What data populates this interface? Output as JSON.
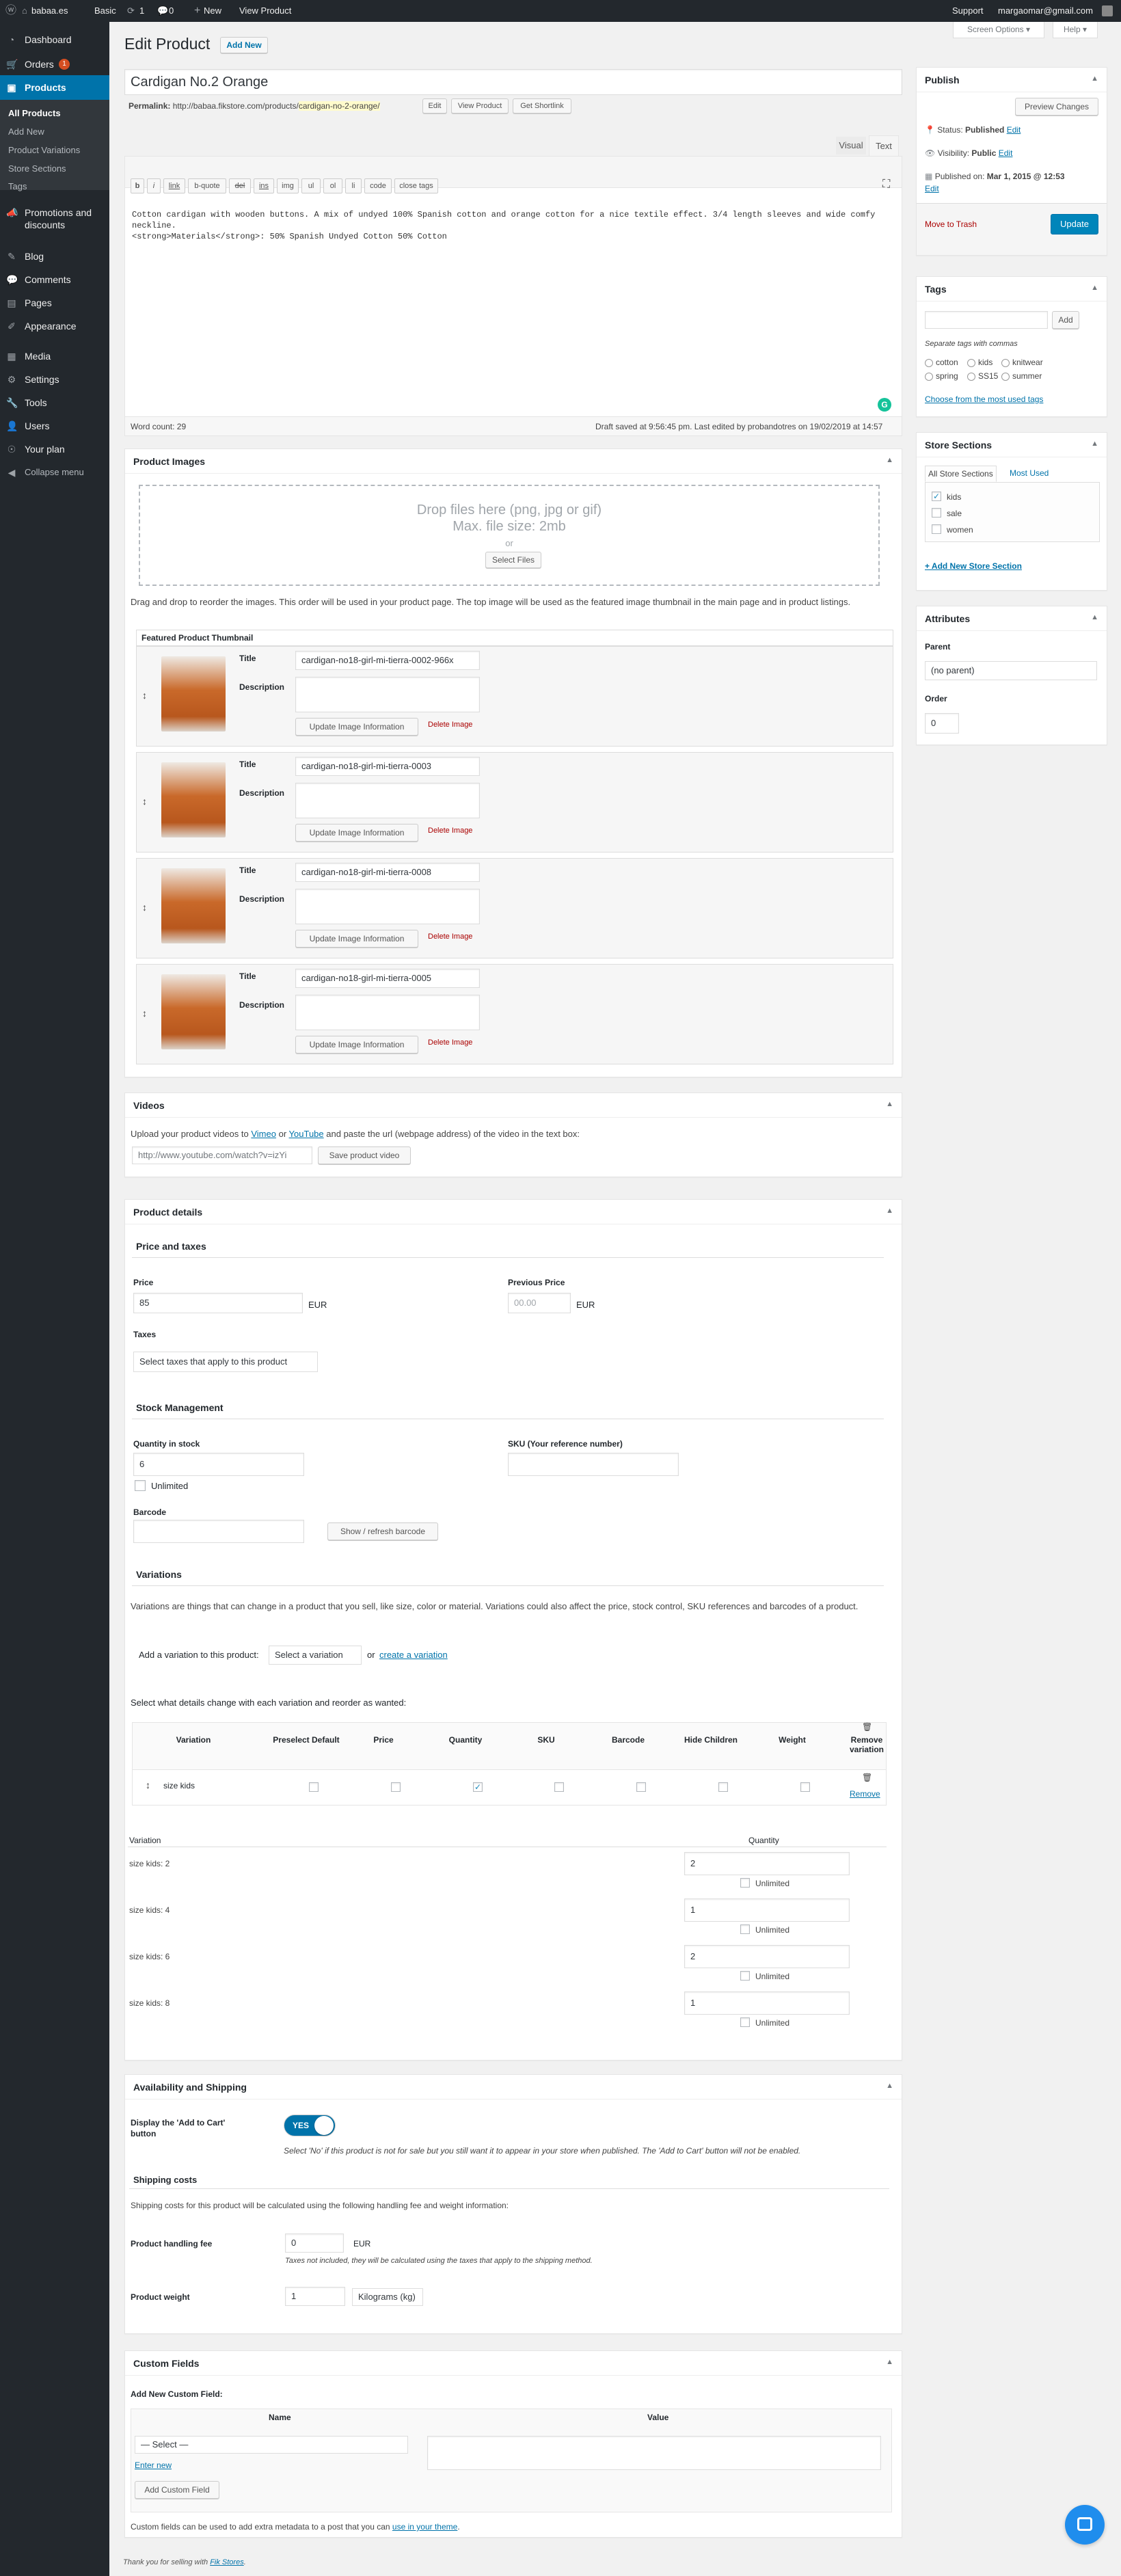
{
  "adminbar": {
    "site": "babaa.es",
    "plan": "Basic",
    "updates": "1",
    "comments": "0",
    "new": "New",
    "view": "View Product",
    "support": "Support",
    "user": "margaomar@gmail.com"
  },
  "menu": {
    "dashboard": "Dashboard",
    "orders": "Orders",
    "orders_badge": "1",
    "products": "Products",
    "products_sub": [
      "All Products",
      "Add New",
      "Product Variations",
      "Store Sections",
      "Tags"
    ],
    "promotions": "Promotions and discounts",
    "blog": "Blog",
    "comments": "Comments",
    "pages": "Pages",
    "appearance": "Appearance",
    "media": "Media",
    "settings": "Settings",
    "tools": "Tools",
    "users": "Users",
    "plan": "Your plan",
    "collapse": "Collapse menu"
  },
  "header": {
    "title": "Edit Product",
    "add_new": "Add New",
    "screen_options": "Screen Options ▾",
    "help": "Help ▾"
  },
  "post": {
    "title": "Cardigan No.2 Orange",
    "permalink_label": "Permalink:",
    "permalink_base": "http://babaa.fikstore.com/products/",
    "permalink_slug": "cardigan-no-2-orange/",
    "edit": "Edit",
    "view_product": "View Product",
    "get_shortlink": "Get Shortlink"
  },
  "editor": {
    "tab_visual": "Visual",
    "tab_text": "Text",
    "quicktags": [
      "b",
      "i",
      "link",
      "b-quote",
      "del",
      "ins",
      "img",
      "ul",
      "ol",
      "li",
      "code",
      "close tags"
    ],
    "content_line1": "Cotton cardigan with wooden buttons. A mix of undyed 100% Spanish cotton and orange cotton for a nice textile effect. 3/4 length sleeves and wide comfy",
    "content_line2": "neckline.",
    "content_line3": "<strong>Materials</strong>: 50% Spanish Undyed Cotton 50% Cotton",
    "word_count": "Word count: 29",
    "draft_saved": "Draft saved at 9:56:45 pm. Last edited by probandotres on 19/02/2019 at 14:57"
  },
  "images": {
    "title": "Product Images",
    "drop": "Drop files here (png, jpg or gif)",
    "max": "Max. file size: 2mb",
    "or": "or",
    "select": "Select Files",
    "help": "Drag and drop to reorder the images. This order will be used in your product page. The top image will be used as the featured image thumbnail in the main page and in product listings.",
    "featured": "Featured Product Thumbnail",
    "title_label": "Title",
    "desc_label": "Description",
    "update": "Update Image Information",
    "delete": "Delete Image",
    "items": [
      {
        "title": "cardigan-no18-girl-mi-tierra-0002-966x"
      },
      {
        "title": "cardigan-no18-girl-mi-tierra-0003"
      },
      {
        "title": "cardigan-no18-girl-mi-tierra-0008"
      },
      {
        "title": "cardigan-no18-girl-mi-tierra-0005"
      }
    ]
  },
  "videos": {
    "title": "Videos",
    "text_pre": "Upload your product videos to",
    "vimeo": "Vimeo",
    "or": "or",
    "youtube": "YouTube",
    "text_post": "and paste the url (webpage address) of the video in the text box:",
    "placeholder": "http://www.youtube.com/watch?v=izYi",
    "save": "Save product video"
  },
  "details": {
    "title": "Product details",
    "price_taxes": "Price and taxes",
    "price_label": "Price",
    "price": "85",
    "currency": "EUR",
    "prev_price_label": "Previous Price",
    "prev_price_placeholder": "00.00",
    "taxes_label": "Taxes",
    "taxes_select": "Select taxes that apply to this product",
    "stock": "Stock Management",
    "qty_label": "Quantity in stock",
    "qty": "6",
    "unlimited": "Unlimited",
    "sku_label": "SKU (Your reference number)",
    "barcode_label": "Barcode",
    "barcode_btn": "Show / refresh barcode",
    "variations": "Variations",
    "var_help": "Variations are things that can change in a product that you sell, like size, color or material. Variations could also affect the price, stock control, SKU references and barcodes of a product.",
    "add_var_label": "Add a variation to this product:",
    "add_var_select": "Select a variation",
    "or": "or",
    "create_var": "create a variation",
    "select_details": "Select what details change with each variation and reorder as wanted:",
    "cols": [
      "Variation",
      "Preselect Default",
      "Price",
      "Quantity",
      "SKU",
      "Barcode",
      "Hide Children",
      "Weight",
      "Remove variation"
    ],
    "var_row": "size kids",
    "remove": "Remove",
    "qty_head_var": "Variation",
    "qty_head_qty": "Quantity",
    "var_qtys": [
      {
        "name": "size kids: 2",
        "qty": "2"
      },
      {
        "name": "size kids: 4",
        "qty": "1"
      },
      {
        "name": "size kids: 6",
        "qty": "2"
      },
      {
        "name": "size kids: 8",
        "qty": "1"
      }
    ]
  },
  "avail": {
    "title": "Availability and Shipping",
    "cart_label": "Display the 'Add to Cart' button",
    "toggle": "YES",
    "cart_help": "Select 'No' if this product is not for sale but you still want it to appear in your store when published. The 'Add to Cart' button will not be enabled.",
    "shipping": "Shipping costs",
    "shipping_help": "Shipping costs for this product will be calculated using the following handling fee and weight information:",
    "fee_label": "Product handling fee",
    "fee": "0",
    "fee_currency": "EUR",
    "fee_help": "Taxes not included, they will be calculated using the taxes that apply to the shipping method.",
    "weight_label": "Product weight",
    "weight": "1",
    "weight_unit": "Kilograms (kg)"
  },
  "custom": {
    "title": "Custom Fields",
    "add_new": "Add New Custom Field:",
    "name_col": "Name",
    "value_col": "Value",
    "select": "— Select —",
    "enter_new": "Enter new",
    "add_btn": "Add Custom Field",
    "footer_text": "Custom fields can be used to add extra metadata to a post that you can",
    "footer_link": "use in your theme",
    "footer_end": "."
  },
  "publish": {
    "title": "Publish",
    "preview": "Preview Changes",
    "status_label": "Status:",
    "status": "Published",
    "edit": "Edit",
    "visibility_label": "Visibility:",
    "visibility": "Public",
    "published_label": "Published on:",
    "published": "Mar 1, 2015 @ 12:53",
    "trash": "Move to Trash",
    "update": "Update"
  },
  "tags": {
    "title": "Tags",
    "add": "Add",
    "sep": "Separate tags with commas",
    "items": [
      "cotton",
      "kids",
      "knitwear",
      "spring",
      "SS15",
      "summer"
    ],
    "choose": "Choose from the most used tags"
  },
  "sections": {
    "title": "Store Sections",
    "tab_all": "All Store Sections",
    "tab_used": "Most Used",
    "items": [
      "kids",
      "sale",
      "women"
    ],
    "add": "+ Add New Store Section"
  },
  "attributes": {
    "title": "Attributes",
    "parent_label": "Parent",
    "parent": "(no parent)",
    "order_label": "Order",
    "order": "0"
  },
  "footer": {
    "text": "Thank you for selling with",
    "link": "Fik Stores",
    "end": "."
  }
}
